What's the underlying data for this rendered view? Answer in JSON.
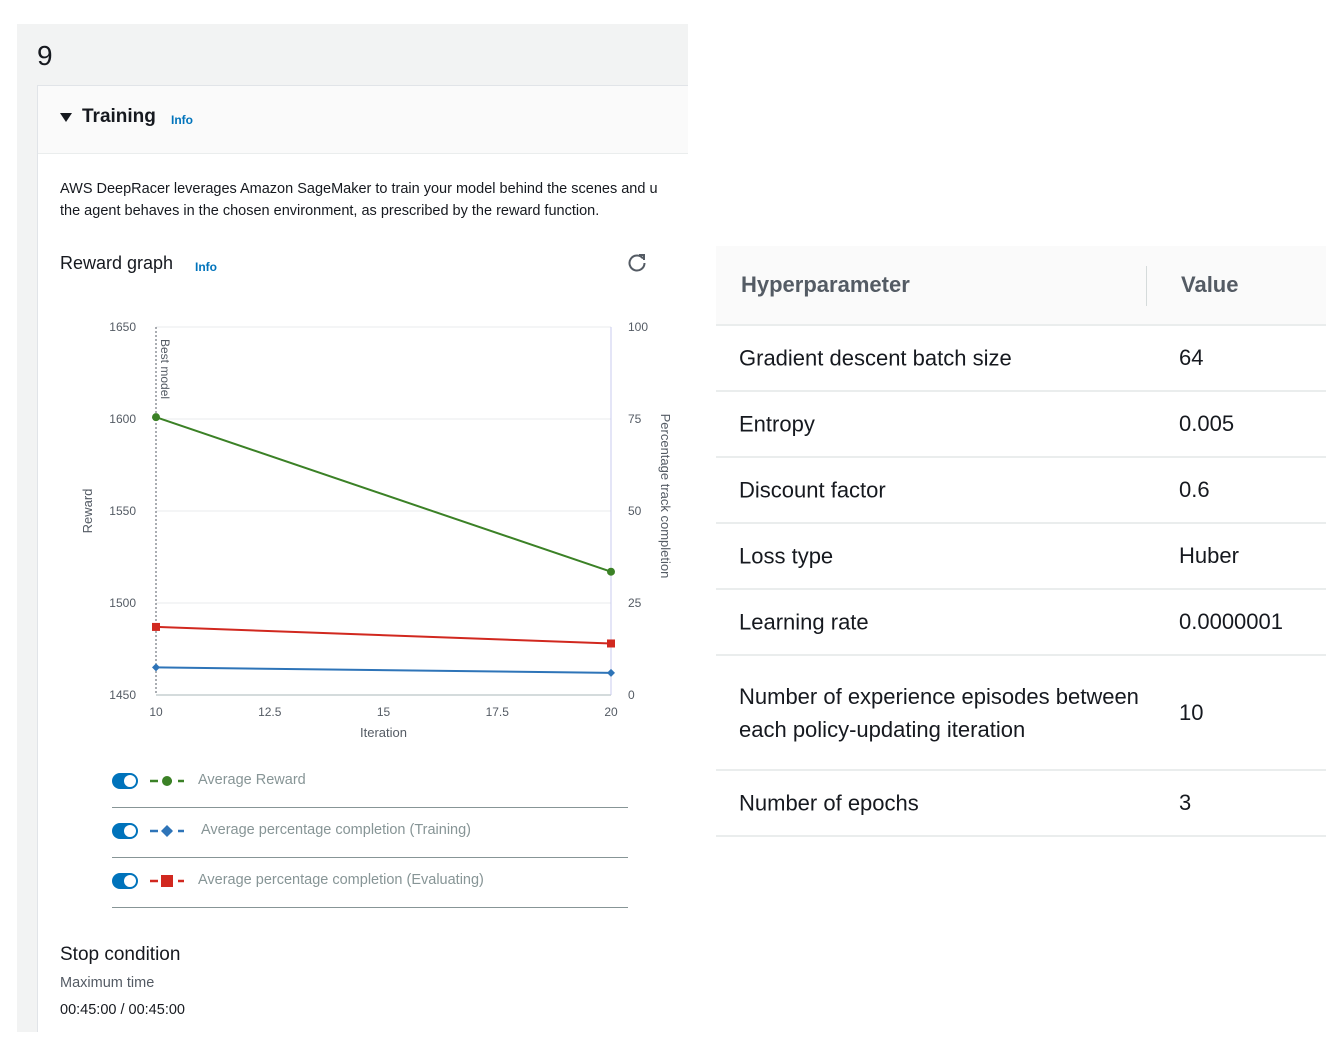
{
  "step": {
    "number": "9"
  },
  "training": {
    "title": "Training",
    "info": "Info",
    "description_line1": "AWS DeepRacer leverages Amazon SageMaker to train your model behind the scenes and u",
    "description_line2": "the agent behaves in the chosen environment, as prescribed by the reward function."
  },
  "reward_graph": {
    "title": "Reward graph",
    "info": "Info"
  },
  "chart_data": {
    "type": "line",
    "xlabel": "Iteration",
    "ylabel": "Reward",
    "y2label": "Percentage track completion",
    "xlim": [
      10,
      20
    ],
    "ylim": [
      1450,
      1650
    ],
    "y2lim": [
      0,
      100
    ],
    "x_ticks": [
      "10",
      "12.5",
      "15",
      "17.5",
      "20"
    ],
    "y_ticks": [
      "1450",
      "1500",
      "1550",
      "1600",
      "1650"
    ],
    "y2_ticks": [
      "0",
      "25",
      "50",
      "75",
      "100"
    ],
    "best_model_label": "Best model",
    "best_model_x": 10,
    "grid": true,
    "series": [
      {
        "name": "Average Reward",
        "axis": "left",
        "x": [
          10,
          20
        ],
        "values": [
          1601,
          1517
        ],
        "color": "#3b8126",
        "marker": "circle"
      },
      {
        "name": "Average percentage completion (Training)",
        "axis": "right",
        "x": [
          10,
          20
        ],
        "values": [
          7.5,
          6
        ],
        "color": "#2e74b8",
        "marker": "diamond"
      },
      {
        "name": "Average percentage completion (Evaluating)",
        "axis": "right",
        "x": [
          10,
          20
        ],
        "values": [
          18.5,
          14
        ],
        "color": "#d1281f",
        "marker": "square"
      }
    ]
  },
  "stop_condition": {
    "title": "Stop condition",
    "label": "Maximum time",
    "value": "00:45:00 / 00:45:00"
  },
  "hyperparameters": {
    "header_name": "Hyperparameter",
    "header_value": "Value",
    "rows": [
      {
        "name": "Gradient descent batch size",
        "value": "64"
      },
      {
        "name": "Entropy",
        "value": "0.005"
      },
      {
        "name": "Discount factor",
        "value": "0.6"
      },
      {
        "name": "Loss type",
        "value": "Huber"
      },
      {
        "name": "Learning rate",
        "value": "0.0000001"
      },
      {
        "name": "Number of experience episodes between each policy-updating iteration",
        "value": "10"
      },
      {
        "name": "Number of epochs",
        "value": "3"
      }
    ]
  }
}
